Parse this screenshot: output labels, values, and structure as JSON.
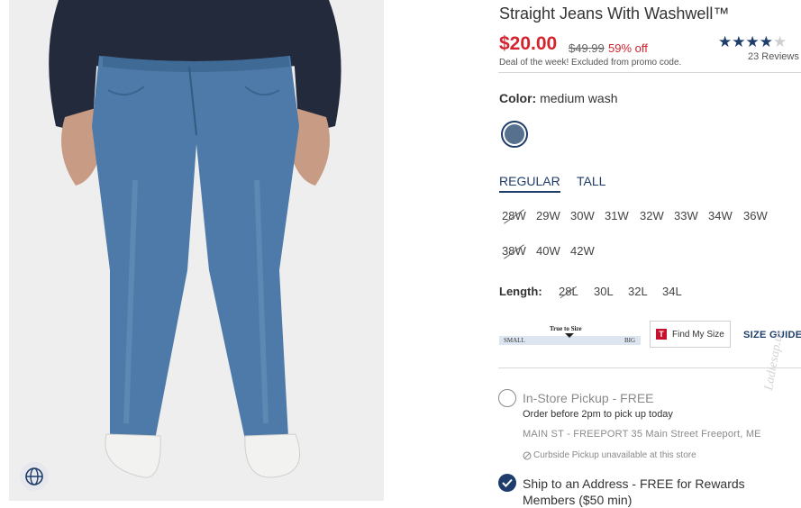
{
  "product": {
    "title": "Straight Jeans With Washwell™",
    "price": "$20.00",
    "original_price": "$49.99",
    "discount": "59% off",
    "deal_note": "Deal of the week! Excluded from promo code.",
    "rating": {
      "value": 4,
      "out_of": 5,
      "reviews_label": "23 Reviews"
    }
  },
  "color": {
    "label": "Color:",
    "value": "medium wash",
    "swatch_hex": "#56708e"
  },
  "fit_tabs": [
    {
      "label": "REGULAR",
      "active": true
    },
    {
      "label": "TALL",
      "active": false
    }
  ],
  "waist_sizes": [
    {
      "label": "28W",
      "available": false
    },
    {
      "label": "29W",
      "available": true
    },
    {
      "label": "30W",
      "available": true
    },
    {
      "label": "31W",
      "available": true
    },
    {
      "label": "32W",
      "available": true
    },
    {
      "label": "33W",
      "available": true
    },
    {
      "label": "34W",
      "available": true
    },
    {
      "label": "36W",
      "available": true
    },
    {
      "label": "38W",
      "available": false
    },
    {
      "label": "40W",
      "available": true
    },
    {
      "label": "42W",
      "available": true
    }
  ],
  "length": {
    "label": "Length:",
    "sizes": [
      {
        "label": "28L",
        "available": false
      },
      {
        "label": "30L",
        "available": true
      },
      {
        "label": "32L",
        "available": true
      },
      {
        "label": "34L",
        "available": true
      }
    ]
  },
  "fit_scale": {
    "true_label": "True to Size",
    "small": "SMALL",
    "big": "BIG"
  },
  "find_my_size": {
    "badge": "T",
    "label": "Find My Size"
  },
  "size_guide": "SIZE GUIDE",
  "fulfillment": {
    "pickup_label": "In-Store Pickup - FREE",
    "pickup_order": "Order before 2pm to pick up today",
    "store": "MAIN ST - FREEPORT 35 Main Street Freeport, ME",
    "curbside": "Curbside Pickup unavailable at this store",
    "ship_label": "Ship to an Address - FREE for Rewards",
    "ship_label_2": "Members ($50 min)"
  },
  "watermark": "Ladiesap.us",
  "colors": {
    "accent": "#1f3d6b",
    "sale": "#d3232f",
    "denim": "#56708e"
  }
}
